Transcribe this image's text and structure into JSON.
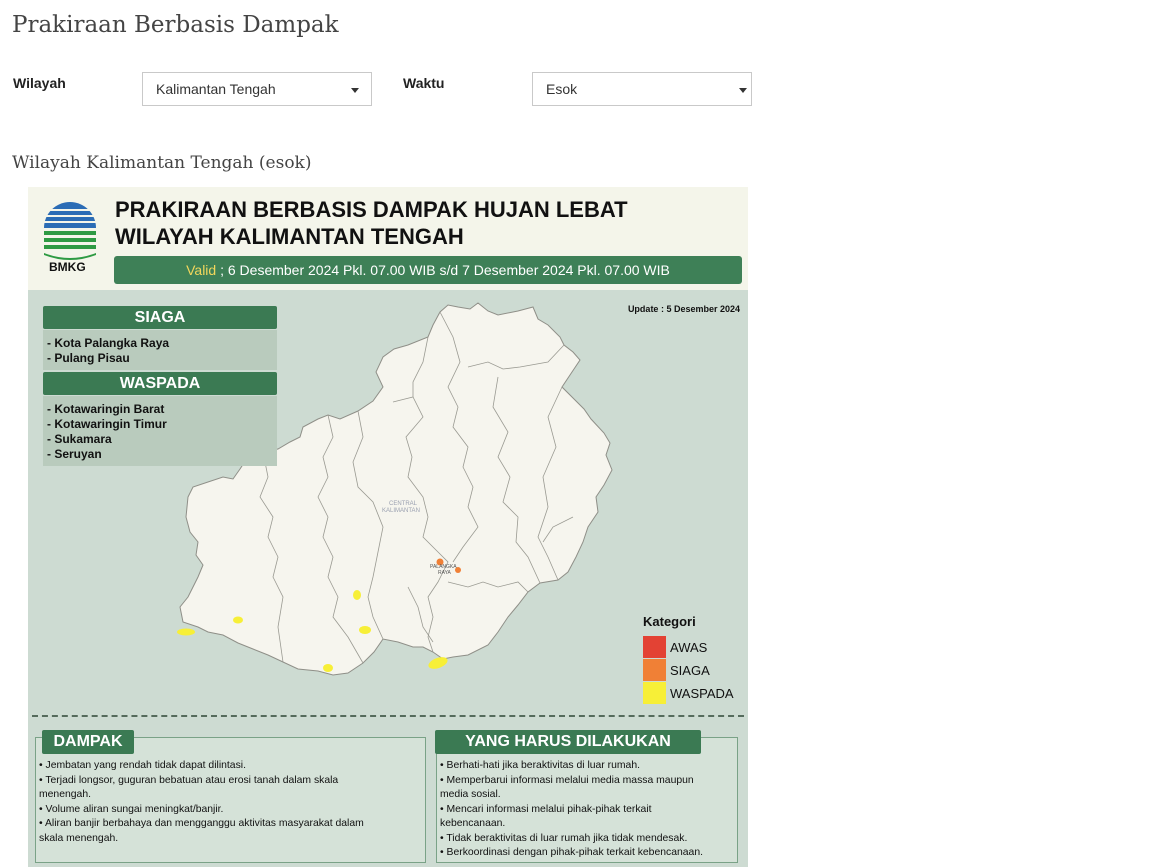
{
  "page": {
    "title": "Prakiraan Berbasis Dampak"
  },
  "filters": {
    "region_label": "Wilayah",
    "region_value": "Kalimantan Tengah",
    "time_label": "Waktu",
    "time_value": "Esok"
  },
  "section_title": "Wilayah Kalimantan Tengah (esok)",
  "poster": {
    "logo_text": "BMKG",
    "title_line1": "PRAKIRAAN BERBASIS DAMPAK HUJAN LEBAT",
    "title_line2": "WILAYAH KALIMANTAN TENGAH",
    "valid_word": "Valid",
    "valid_text": " ; 6 Desember 2024 Pkl. 07.00 WIB s/d 7 Desember 2024 Pkl. 07.00 WIB",
    "update": "Update : 5 Desember 2024",
    "siaga": {
      "label": "SIAGA",
      "areas": [
        "- Kota Palangka Raya",
        "- Pulang Pisau"
      ]
    },
    "waspada": {
      "label": "WASPADA",
      "areas": [
        "- Kotawaringin Barat",
        "- Kotawaringin Timur",
        "- Sukamara",
        "- Seruyan"
      ]
    },
    "map": {
      "region_label_1": "CENTRAL",
      "region_label_2": "KALIMANTAN",
      "city_label_1": "PALANGKA",
      "city_label_2": "RAYA"
    },
    "legend": {
      "title": "Kategori",
      "items": [
        {
          "label": "AWAS",
          "color": "#e34234"
        },
        {
          "label": "SIAGA",
          "color": "#f08036"
        },
        {
          "label": "WASPADA",
          "color": "#f7ef37"
        }
      ]
    },
    "dampak": {
      "title": "DAMPAK",
      "items": [
        "• Jembatan yang rendah tidak dapat dilintasi.",
        "• Terjadi longsor, guguran bebatuan atau erosi tanah dalam skala",
        "menengah.",
        "• Volume aliran sungai meningkat/banjir.",
        "• Aliran banjir berbahaya dan mengganggu aktivitas masyarakat dalam",
        "skala menengah."
      ]
    },
    "tindakan": {
      "title": "YANG HARUS DILAKUKAN",
      "items": [
        "• Berhati-hati jika beraktivitas di luar rumah.",
        "• Memperbarui informasi melalui media massa maupun",
        "media sosial.",
        "• Mencari informasi melalui pihak-pihak terkait",
        "kebencanaan.",
        "• Tidak beraktivitas di luar rumah jika tidak mendesak.",
        "• Berkoordinasi dengan pihak-pihak terkait kebencanaan."
      ]
    }
  }
}
